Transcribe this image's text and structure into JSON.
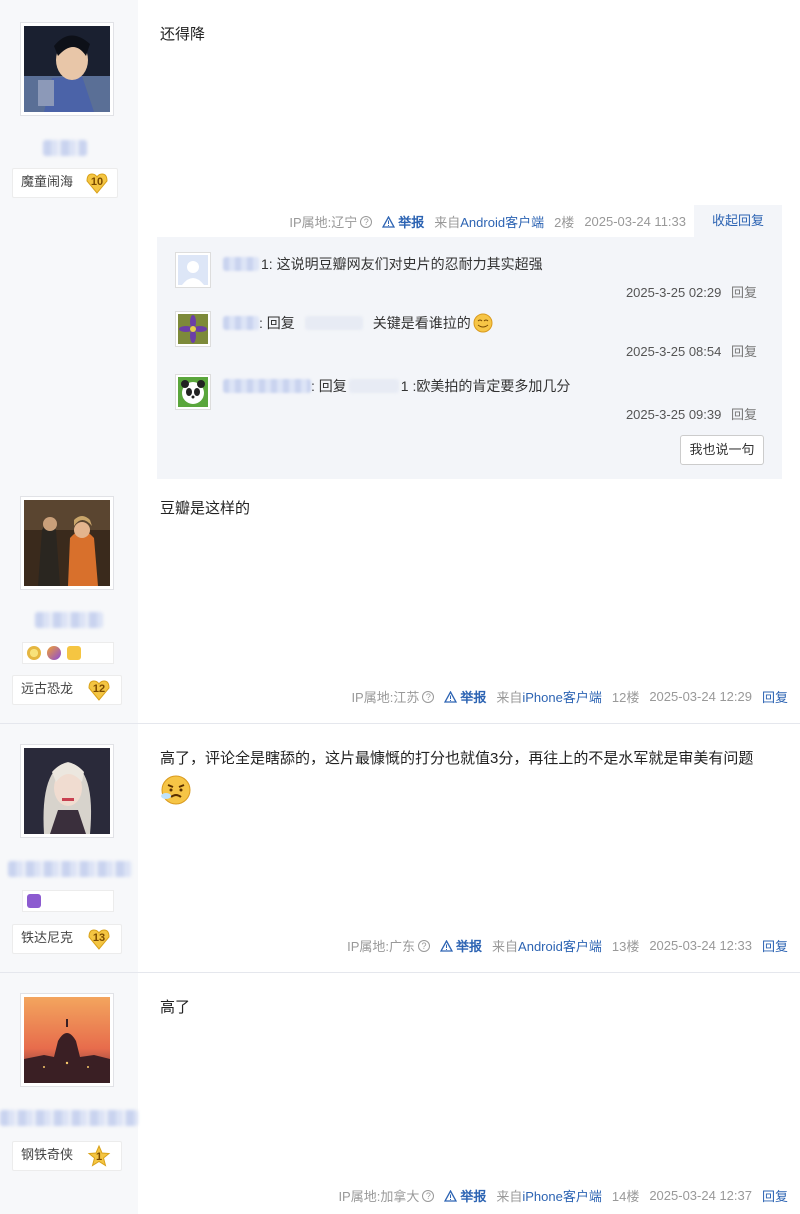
{
  "posts": [
    {
      "rank": "魔童闹海",
      "level": "10",
      "content": "还得降",
      "ip": "IP属地:辽宁",
      "report": "举报",
      "from_prefix": "来自",
      "from_client": "Android客户端",
      "floor": "2楼",
      "time": "2025-03-24 11:33",
      "collapse": "收起回复",
      "replies": [
        {
          "text": "1: 这说明豆瓣网友们对史片的忍耐力其实超强",
          "time": "2025-3-25 02:29",
          "reply": "回复"
        },
        {
          "prefix": ": 回复",
          "text": "关键是看谁拉的",
          "time": "2025-3-25 08:54",
          "reply": "回复"
        },
        {
          "prefix": ": 回复",
          "text": "1 :欧美拍的肯定要多加几分",
          "time": "2025-3-25 09:39",
          "reply": "回复"
        }
      ],
      "say_button": "我也说一句"
    },
    {
      "rank": "远古恐龙",
      "level": "12",
      "content": "豆瓣是这样的",
      "ip": "IP属地:江苏",
      "report": "举报",
      "from_prefix": "来自",
      "from_client": "iPhone客户端",
      "floor": "12楼",
      "time": "2025-03-24 12:29",
      "reply": "回复"
    },
    {
      "rank": "铁达尼克",
      "level": "13",
      "content": "高了，评论全是瞎舔的，这片最慷慨的打分也就值3分，再往上的不是水军就是审美有问题",
      "ip": "IP属地:广东",
      "report": "举报",
      "from_prefix": "来自",
      "from_client": "Android客户端",
      "floor": "13楼",
      "time": "2025-03-24 12:33",
      "reply": "回复"
    },
    {
      "rank": "钢铁奇侠",
      "level": "1",
      "content": "高了",
      "ip": "IP属地:加拿大",
      "report": "举报",
      "from_prefix": "来自",
      "from_client": "iPhone客户端",
      "floor": "14楼",
      "time": "2025-03-24 12:37",
      "reply": "回复"
    }
  ],
  "colors": {
    "link": "#2d64b3",
    "sidebar": "#f7f8fa",
    "lzl_bg": "#f3f5f9",
    "badge_gold": "#f4c542"
  },
  "icons": [
    "warning-triangle-icon",
    "help-circle-icon",
    "smile-emoji-icon",
    "angry-emoji-icon",
    "level-heart-icon",
    "level-star-icon",
    "cancer-zodiac-icon"
  ]
}
